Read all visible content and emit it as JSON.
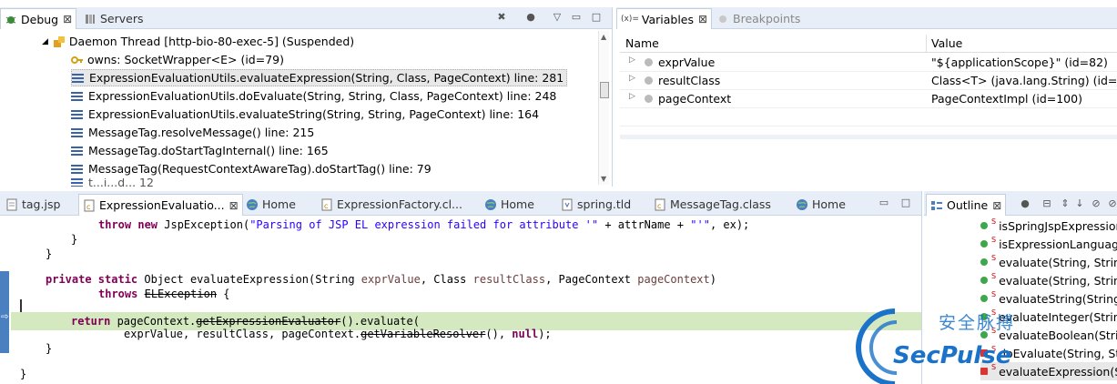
{
  "debug": {
    "tabs": [
      {
        "label": "Debug",
        "close": "⊠",
        "active": true
      },
      {
        "label": "Servers",
        "active": false
      }
    ],
    "thread": "Daemon Thread [http-bio-80-exec-5] (Suspended)",
    "owns": "owns: SocketWrapper<E>  (id=79)",
    "frames": [
      "ExpressionEvaluationUtils.evaluateExpression(String, Class, PageContext) line: 281",
      "ExpressionEvaluationUtils.doEvaluate(String, String, Class, PageContext) line: 248",
      "ExpressionEvaluationUtils.evaluateString(String, String, PageContext) line: 164",
      "MessageTag.resolveMessage() line: 215",
      "MessageTag.doStartTagInternal() line: 165",
      "MessageTag(RequestContextAwareTag).doStartTag() line: 79"
    ],
    "partial_frame": "t...i...d... 12"
  },
  "variables": {
    "tabs": [
      {
        "label": "Variables",
        "prefix": "(x)=",
        "close": "⊠",
        "active": true
      },
      {
        "label": "Breakpoints",
        "active": false
      }
    ],
    "columns": {
      "name": "Name",
      "value": "Value"
    },
    "rows": [
      {
        "name": "exprValue",
        "value": "\"${applicationScope}\" (id=82)"
      },
      {
        "name": "resultClass",
        "value": "Class<T> (java.lang.String) (id=84)"
      },
      {
        "name": "pageContext",
        "value": "PageContextImpl  (id=100)"
      }
    ]
  },
  "editor": {
    "tabs": [
      {
        "label": "tag.jsp"
      },
      {
        "label": "ExpressionEvaluatio...",
        "close": "⊠",
        "active": true
      },
      {
        "label": "Home"
      },
      {
        "label": "ExpressionFactory.cl..."
      },
      {
        "label": "Home"
      },
      {
        "label": "spring.tld"
      },
      {
        "label": "MessageTag.class"
      },
      {
        "label": "Home"
      }
    ],
    "code": {
      "l1_kw": "throw new",
      "l1_a": " JspException(",
      "l1_str": "\"Parsing of JSP EL expression failed for attribute '\"",
      "l1_b": " + attrName + ",
      "l1_str2": "\"'\"",
      "l1_c": ", ex);",
      "l2": "}",
      "l3": "}",
      "l4_kw": "private static",
      "l4_a": " Object evaluateExpression(String ",
      "l4_p1": "exprValue",
      "l4_b": ", Class ",
      "l4_p2": "resultClass",
      "l4_c": ", PageContext ",
      "l4_p3": "pageContext",
      "l4_d": ")",
      "l5_kw": "throws",
      "l5_strike": "ELException",
      "l5_a": " {",
      "l7_kw": "return",
      "l7_a": " pageContext.",
      "l7_strike": "getExpressionEvaluator",
      "l7_b": "().evaluate(",
      "l8_a": "exprValue, resultClass, pageContext.",
      "l8_strike": "getVariableResolver",
      "l8_b": "(), ",
      "l8_kw": "null",
      "l8_c": ");",
      "l9": "}",
      "l10": "}"
    }
  },
  "outline": {
    "tab": {
      "label": "Outline",
      "close": "⊠"
    },
    "items": [
      "isSpringJspExpression",
      "isExpressionLanguage",
      "evaluate(String, String",
      "evaluate(String, String",
      "evaluateString(String,",
      "evaluateInteger(String",
      "evaluateBoolean(Strin",
      "doEvaluate(String, Stri",
      "evaluateExpression(St"
    ]
  },
  "watermark": {
    "cn": "安全脉搏",
    "en": "SecPulse"
  },
  "colors": {
    "keyword": "#7f0055",
    "string": "#2a00ff",
    "current_line": "#d4e9c0",
    "tab_bar": "#e8eef7",
    "frame_icon": "#3863a8",
    "watermark": "#1a73c8"
  }
}
